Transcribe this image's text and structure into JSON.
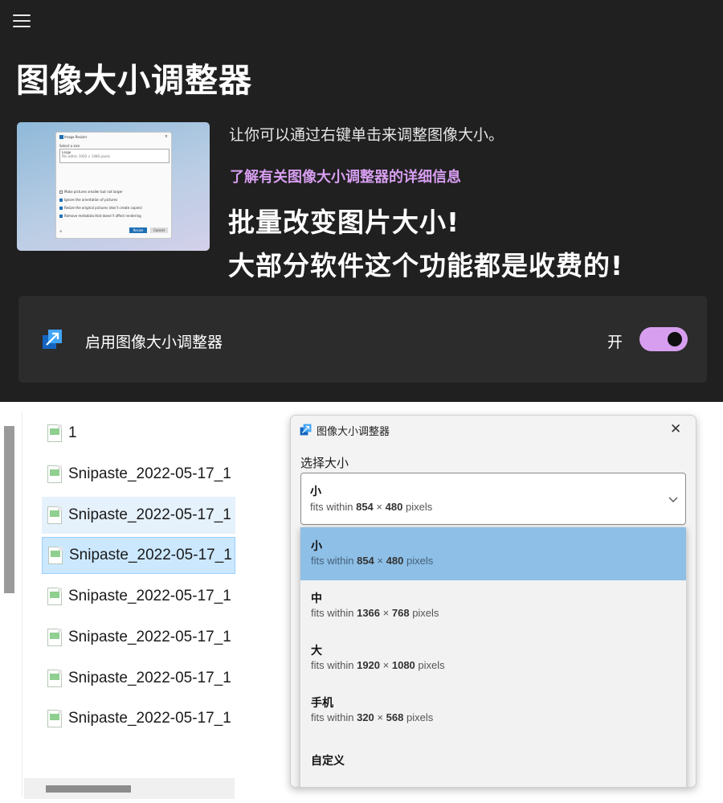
{
  "settings": {
    "page_title": "图像大小调整器",
    "description": "让你可以通过右键单击来调整图像大小。",
    "learn_more": "了解有关图像大小调整器的详细信息",
    "promo_line1": "批量改变图片大小!",
    "promo_line2": "大部分软件这个功能都是收费的!",
    "enable_label": "启用图像大小调整器",
    "toggle_state": "开",
    "accent_color": "#d79ef0"
  },
  "preview": {
    "title": "Image Resizer",
    "select_label": "Select a size",
    "size_name": "Large",
    "size_desc": "fits within 1920 × 1080 pixels",
    "options": [
      "Make pictures smaller but not larger",
      "Ignore the orientation of pictures",
      "Resize the original pictures (don't create copies)",
      "Remove metadata that doesn't affect rendering"
    ],
    "resize_button": "Resize",
    "cancel_button": "Cancel"
  },
  "explorer": {
    "files": [
      "1",
      "Snipaste_2022-05-17_1",
      "Snipaste_2022-05-17_1",
      "Snipaste_2022-05-17_1",
      "Snipaste_2022-05-17_1",
      "Snipaste_2022-05-17_1",
      "Snipaste_2022-05-17_1",
      "Snipaste_2022-05-17_1"
    ]
  },
  "dialog": {
    "title": "图像大小调整器",
    "close": "✕",
    "select_size_label": "选择大小",
    "fits_within": "fits within",
    "times": "×",
    "pixels": "pixels",
    "selected": {
      "name": "小",
      "w": "854",
      "h": "480"
    },
    "sizes": [
      {
        "name": "小",
        "w": "854",
        "h": "480"
      },
      {
        "name": "中",
        "w": "1366",
        "h": "768"
      },
      {
        "name": "大",
        "w": "1920",
        "h": "1080"
      },
      {
        "name": "手机",
        "w": "320",
        "h": "568"
      },
      {
        "name": "自定义"
      }
    ]
  }
}
